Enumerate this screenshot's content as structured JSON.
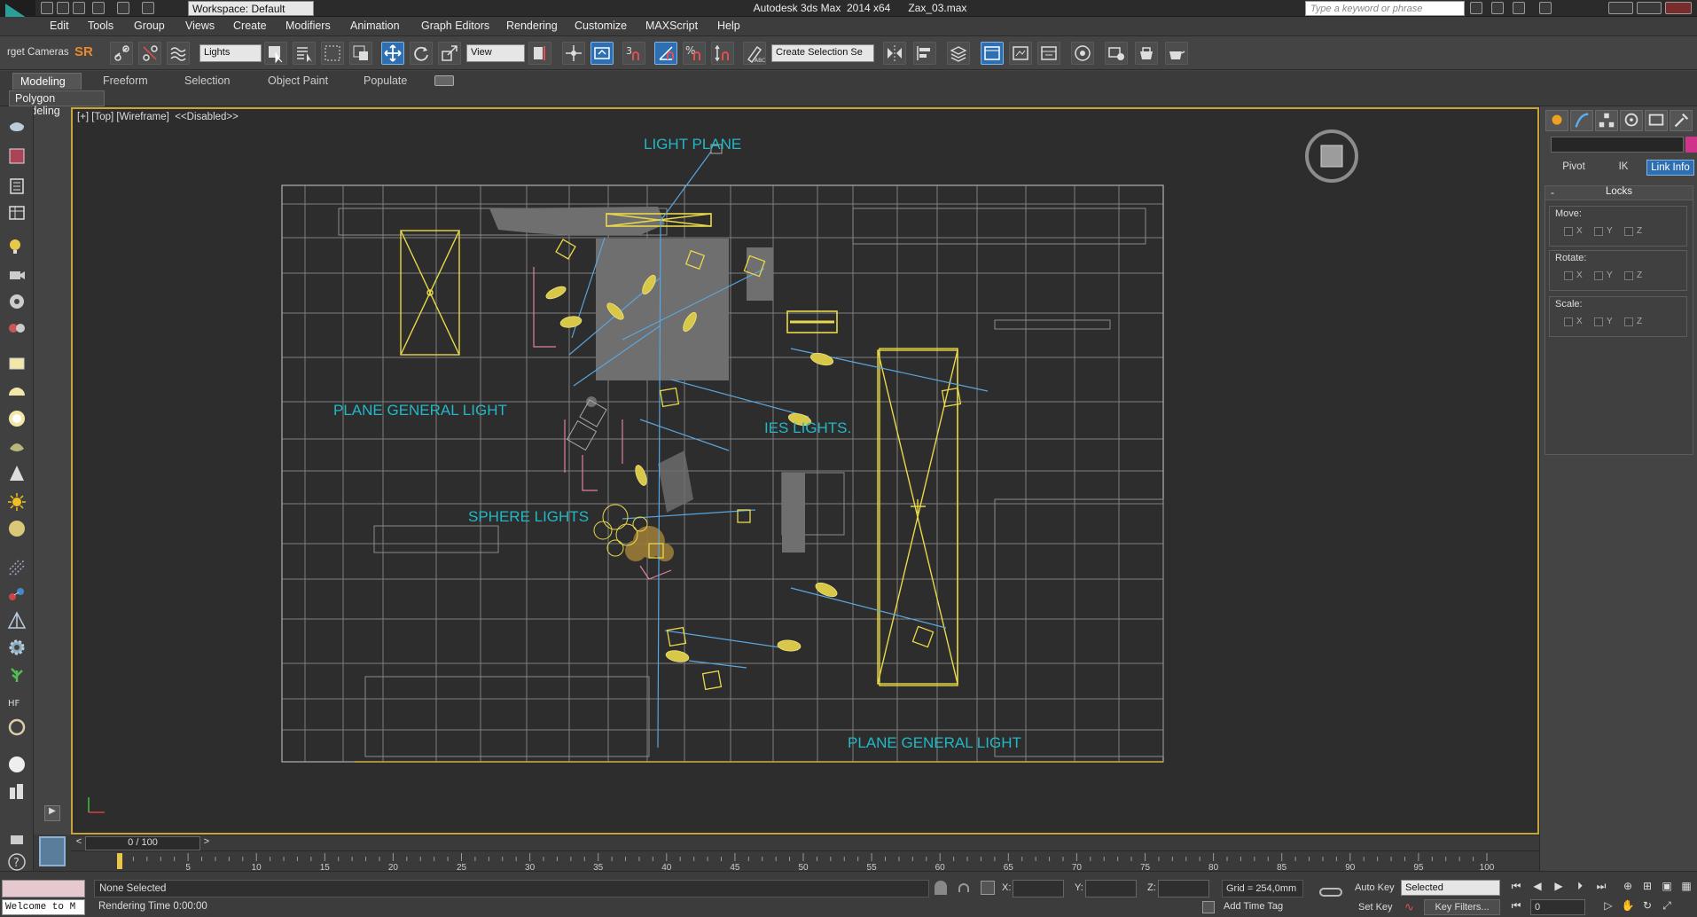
{
  "titlebar": {
    "workspace": "Workspace: Default",
    "title": "Autodesk 3ds Max  2014 x64      Zax_03.max",
    "search_placeholder": "Type a keyword or phrase"
  },
  "menu": [
    "Edit",
    "Tools",
    "Group",
    "Views",
    "Create",
    "Modifiers",
    "Animation",
    "Graph Editors",
    "Rendering",
    "Customize",
    "MAXScript",
    "Help"
  ],
  "toolbar": {
    "target_cameras": "rget Cameras",
    "sr": "SR",
    "selection_filter": "Lights",
    "ref_coord": "View",
    "named_selection": "Create Selection Se"
  },
  "ribbon": {
    "tabs": [
      "Modeling",
      "Freeform",
      "Selection",
      "Object Paint",
      "Populate"
    ],
    "active_tab": "Modeling",
    "panel": "Polygon Modeling"
  },
  "viewport": {
    "label": "[+] [Top] [Wireframe]  <<Disabled>>",
    "notes": {
      "light_plane": "LIGHT PLANE",
      "plane_general_light_left": "PLANE GENERAL LIGHT",
      "ies_lights": "IES LIGHTS.",
      "sphere_lights": "SPHERE LIGHTS",
      "plane_general_light_bottom": "PLANE GENERAL LIGHT"
    }
  },
  "command_panel": {
    "tabs": [
      "Pivot",
      "IK",
      "Link Info"
    ],
    "active_tab": "Link Info",
    "rollout_title": "Locks",
    "groups": [
      {
        "title": "Move:",
        "axes": [
          "X",
          "Y",
          "Z"
        ]
      },
      {
        "title": "Rotate:",
        "axes": [
          "X",
          "Y",
          "Z"
        ]
      },
      {
        "title": "Scale:",
        "axes": [
          "X",
          "Y",
          "Z"
        ]
      }
    ]
  },
  "timeline": {
    "frame_display": "0 / 100",
    "ticks": [
      "5",
      "10",
      "15",
      "20",
      "25",
      "30",
      "35",
      "40",
      "45",
      "50",
      "55",
      "60",
      "65",
      "70",
      "75",
      "80",
      "85",
      "90",
      "95",
      "100"
    ]
  },
  "status": {
    "maxscript_listener": "Welcome to M",
    "selection": "None Selected",
    "rendering_time": "Rendering Time  0:00:00",
    "x_label": "X:",
    "y_label": "Y:",
    "z_label": "Z:",
    "grid": "Grid = 254,0mm",
    "add_time_tag": "Add Time Tag",
    "auto_key": "Auto Key",
    "set_key": "Set Key",
    "selected_dd": "Selected",
    "key_filters": "Key Filters...",
    "current_frame": "0"
  }
}
